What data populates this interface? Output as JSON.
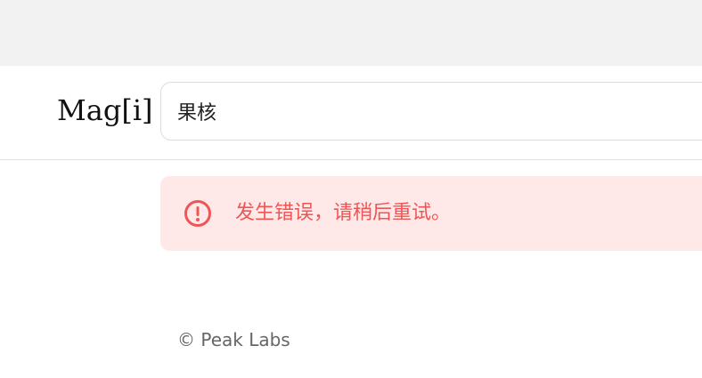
{
  "header": {
    "logo": "Mag[i]"
  },
  "search": {
    "value": "果核"
  },
  "alert": {
    "icon": "exclamation-circle-icon",
    "message": "发生错误，请稍后重试。",
    "color": "#f05555",
    "background": "#ffe8e8"
  },
  "footer": {
    "copyright": "© Peak Labs"
  }
}
